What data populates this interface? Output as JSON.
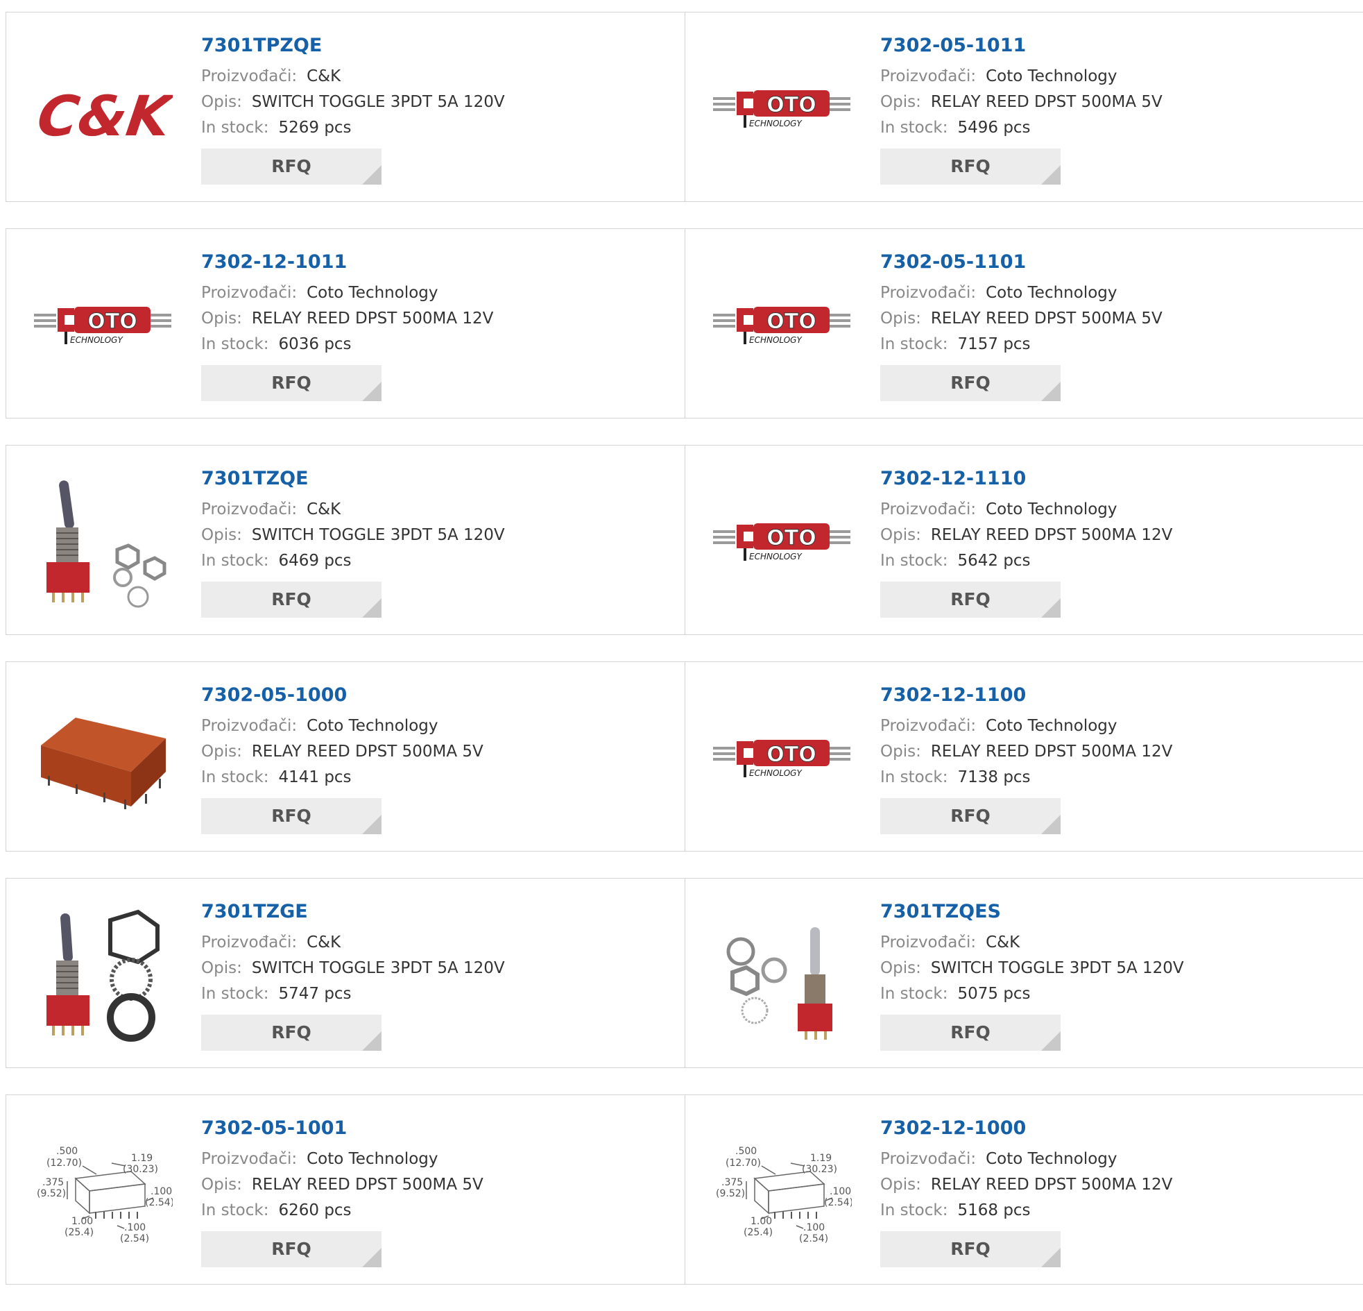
{
  "labels": {
    "manufacturer": "Proizvođači:",
    "description": "Opis:",
    "stock": "In stock:",
    "rfq": "RFQ"
  },
  "logos": {
    "ck_text": "C&K",
    "coto_main": "OTO",
    "coto_sub": "ECHNOLOGY"
  },
  "dimension_drawing": {
    "labels": [
      ".500",
      "(12.70)",
      "1.19",
      "(30.23)",
      ".375",
      "(9.52)",
      ".100",
      "(2.54)",
      "1.00",
      "(25.4)",
      ".100",
      "(2.54)"
    ]
  },
  "products": [
    {
      "part": "7301TPZQE",
      "manufacturer": "C&K",
      "description": "SWITCH TOGGLE 3PDT 5A 120V",
      "stock": "5269 pcs",
      "image": "ck-logo"
    },
    {
      "part": "7302-05-1011",
      "manufacturer": "Coto Technology",
      "description": "RELAY REED DPST 500MA 5V",
      "stock": "5496 pcs",
      "image": "coto-logo"
    },
    {
      "part": "7302-12-1011",
      "manufacturer": "Coto Technology",
      "description": "RELAY REED DPST 500MA 12V",
      "stock": "6036 pcs",
      "image": "coto-logo"
    },
    {
      "part": "7302-05-1101",
      "manufacturer": "Coto Technology",
      "description": "RELAY REED DPST 500MA 5V",
      "stock": "7157 pcs",
      "image": "coto-logo"
    },
    {
      "part": "7301TZQE",
      "manufacturer": "C&K",
      "description": "SWITCH TOGGLE 3PDT 5A 120V",
      "stock": "6469 pcs",
      "image": "toggle-switch-photo"
    },
    {
      "part": "7302-12-1110",
      "manufacturer": "Coto Technology",
      "description": "RELAY REED DPST 500MA 12V",
      "stock": "5642 pcs",
      "image": "coto-logo"
    },
    {
      "part": "7302-05-1000",
      "manufacturer": "Coto Technology",
      "description": "RELAY REED DPST 500MA 5V",
      "stock": "4141 pcs",
      "image": "relay-photo"
    },
    {
      "part": "7302-12-1100",
      "manufacturer": "Coto Technology",
      "description": "RELAY REED DPST 500MA 12V",
      "stock": "7138 pcs",
      "image": "coto-logo"
    },
    {
      "part": "7301TZGE",
      "manufacturer": "C&K",
      "description": "SWITCH TOGGLE 3PDT 5A 120V",
      "stock": "5747 pcs",
      "image": "toggle-switch-nuts-photo"
    },
    {
      "part": "7301TZQES",
      "manufacturer": "C&K",
      "description": "SWITCH TOGGLE 3PDT 5A 120V",
      "stock": "5075 pcs",
      "image": "toggle-switch-washers-photo"
    },
    {
      "part": "7302-05-1001",
      "manufacturer": "Coto Technology",
      "description": "RELAY REED DPST 500MA 5V",
      "stock": "6260 pcs",
      "image": "dimension-drawing"
    },
    {
      "part": "7302-12-1000",
      "manufacturer": "Coto Technology",
      "description": "RELAY REED DPST 500MA 12V",
      "stock": "5168 pcs",
      "image": "dimension-drawing"
    }
  ],
  "colors": {
    "part_link": "#1660a8",
    "label": "#888888",
    "value": "#333333",
    "rfq_bg": "#ececec",
    "card_border": "#d4d4d4",
    "logo_red": "#c1272d"
  }
}
